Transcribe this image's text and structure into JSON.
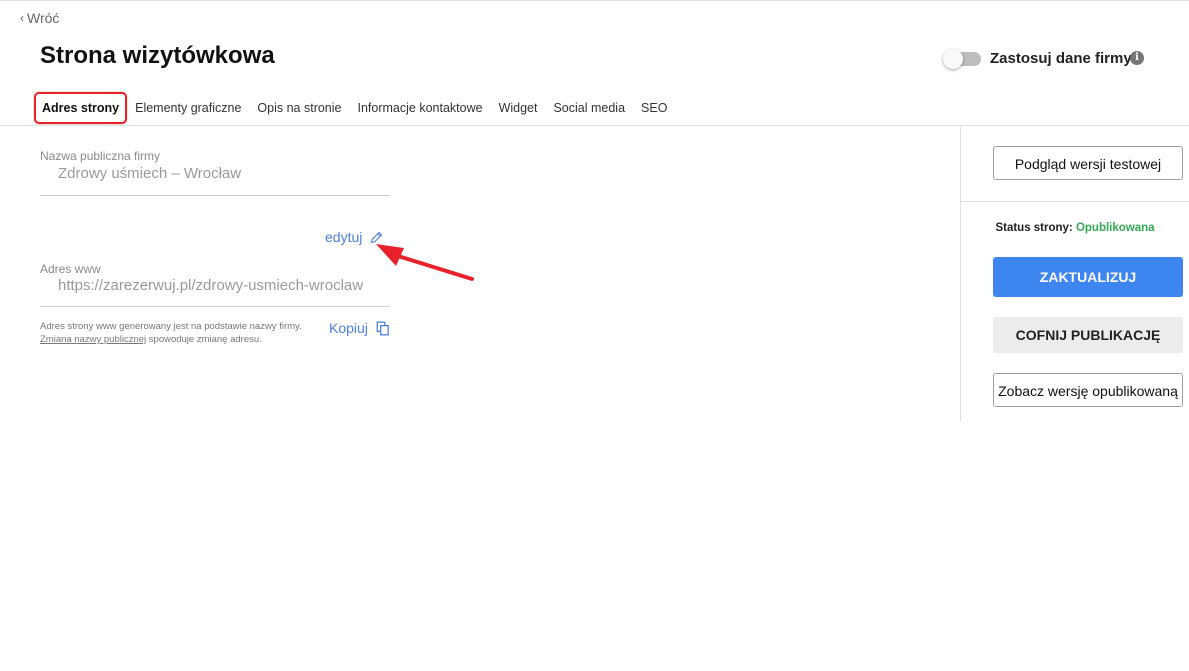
{
  "nav": {
    "back_label": "Wróć"
  },
  "page": {
    "title": "Strona wizytówkowa"
  },
  "company_toggle": {
    "label": "Zastosuj dane firmy",
    "on": false,
    "info_glyph": "i"
  },
  "tabs": [
    {
      "label": "Adres strony",
      "active": true
    },
    {
      "label": "Elementy graficzne",
      "active": false
    },
    {
      "label": "Opis na stronie",
      "active": false
    },
    {
      "label": "Informacje kontaktowe",
      "active": false
    },
    {
      "label": "Widget",
      "active": false
    },
    {
      "label": "Social media",
      "active": false
    },
    {
      "label": "SEO",
      "active": false
    }
  ],
  "form": {
    "public_name": {
      "label": "Nazwa publiczna firmy",
      "value": "Zdrowy uśmiech – Wrocław"
    },
    "edit_label": "edytuj",
    "www": {
      "label": "Adres www",
      "value": "https://zarezerwuj.pl/zdrowy-usmiech-wroclaw"
    },
    "hint_line1": "Adres strony www generowany jest na podstawie nazwy firmy.",
    "hint_link": "Zmiana nazwy publicznej",
    "hint_line2": " spowoduje zmianę adresu.",
    "copy_label": "Kopiuj"
  },
  "sidebar": {
    "preview_button": "Podgląd wersji testowej",
    "status_label": "Status strony: ",
    "status_value": "Opublikowana",
    "update_button": "ZAKTUALIZUJ",
    "unpublish_button": "COFNIJ PUBLIKACJĘ",
    "view_published_button": "Zobacz wersję opublikowaną"
  },
  "colors": {
    "accent_blue": "#3d86f0",
    "link_blue": "#4a7fe0",
    "status_green": "#34a853",
    "highlight_red": "#e0262b"
  },
  "icons": {
    "back": "chevron-left-icon",
    "edit": "pencil-icon",
    "copy": "copy-icon",
    "info": "info-icon"
  }
}
